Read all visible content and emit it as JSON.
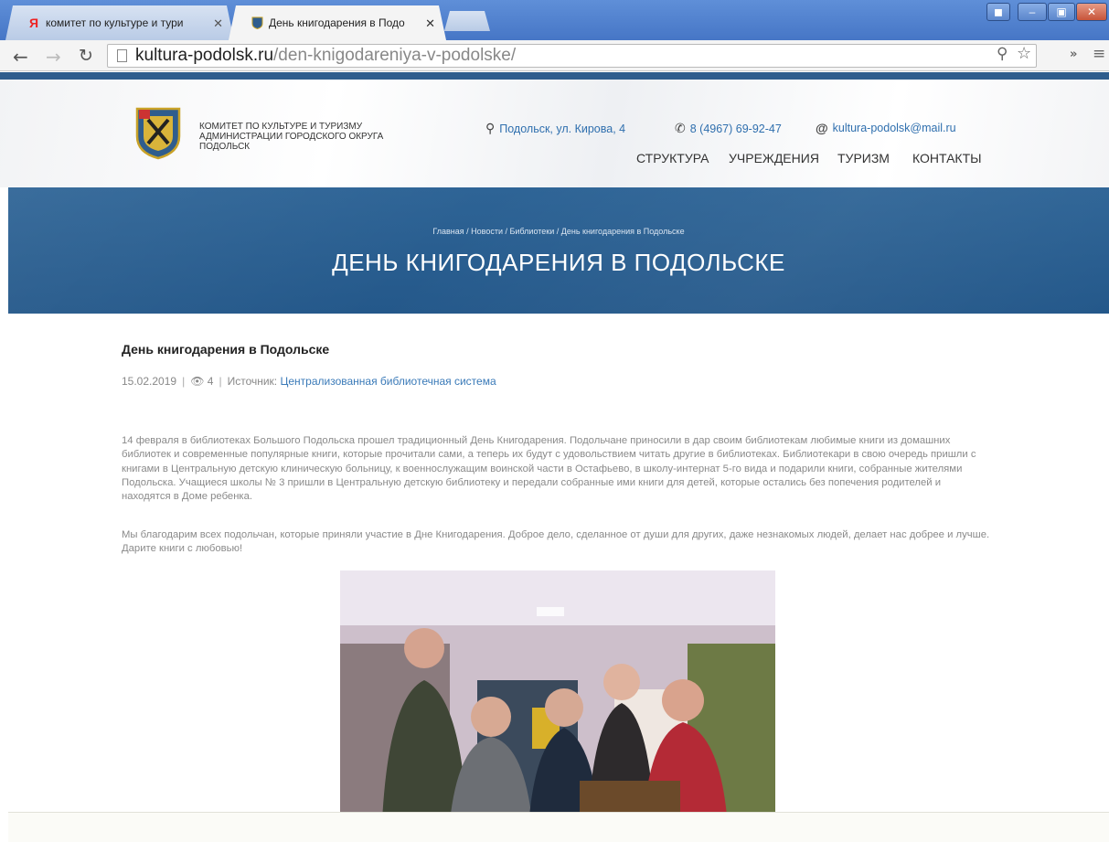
{
  "browser": {
    "tabs": [
      {
        "favicon": "yandex-icon",
        "title": "комитет по культуре и тури",
        "active": false
      },
      {
        "favicon": "crest-icon",
        "title": "День книгодарения в Подо",
        "active": true
      }
    ],
    "url": {
      "host": "kultura-podolsk.ru",
      "path": "/den-knigodareniya-v-podolske/"
    }
  },
  "header": {
    "org_name": "КОМИТЕТ ПО КУЛЬТУРЕ И ТУРИЗМУ АДМИНИСТРАЦИИ ГОРОДСКОГО ОКРУГА ПОДОЛЬСК",
    "address": "Подольск, ул. Кирова, 4",
    "phone": "8 (4967) 69-92-47",
    "email": "kultura-podolsk@mail.ru",
    "nav": [
      "СТРУКТУРА",
      "УЧРЕЖДЕНИЯ",
      "ТУРИЗМ",
      "КОНТАКТЫ"
    ]
  },
  "banner": {
    "breadcrumbs": "Главная / Новости / Библиотеки / День книгодарения в Подольске",
    "title": "ДЕНЬ КНИГОДАРЕНИЯ В ПОДОЛЬСКЕ"
  },
  "article": {
    "title": "День книгодарения в Подольске",
    "date": "15.02.2019",
    "views": "4",
    "source_label": "Источник:",
    "source_link": "Централизованная библиотечная система",
    "paragraphs": [
      "14 февраля в библиотеках Большого Подольска прошел традиционный День Книгодарения. Подольчане приносили в дар своим библиотекам любимые книги из домашних библиотек и современные популярные книги, которые прочитали сами, а теперь их будут с удовольствием читать другие в библиотеках. Библиотекари в свою очередь пришли с книгами в Центральную детскую клиническую больницу, к военнослужащим воинской части в Остафьево, в школу-интернат 5-го вида и подарили книги, собранные жителями Подольска. Учащиеся школы № 3 пришли в Центральную детскую библиотеку и передали собранные ими книги для детей, которые остались без попечения родителей и находятся в Доме ребенка.",
      "Мы благодарим всех подольчан, которые приняли участие в Дне Книгодарения.   Доброе дело, сделанное от души для других, даже незнакомых людей, делает нас добрее и лучше. Дарите книги с любовью!"
    ]
  }
}
